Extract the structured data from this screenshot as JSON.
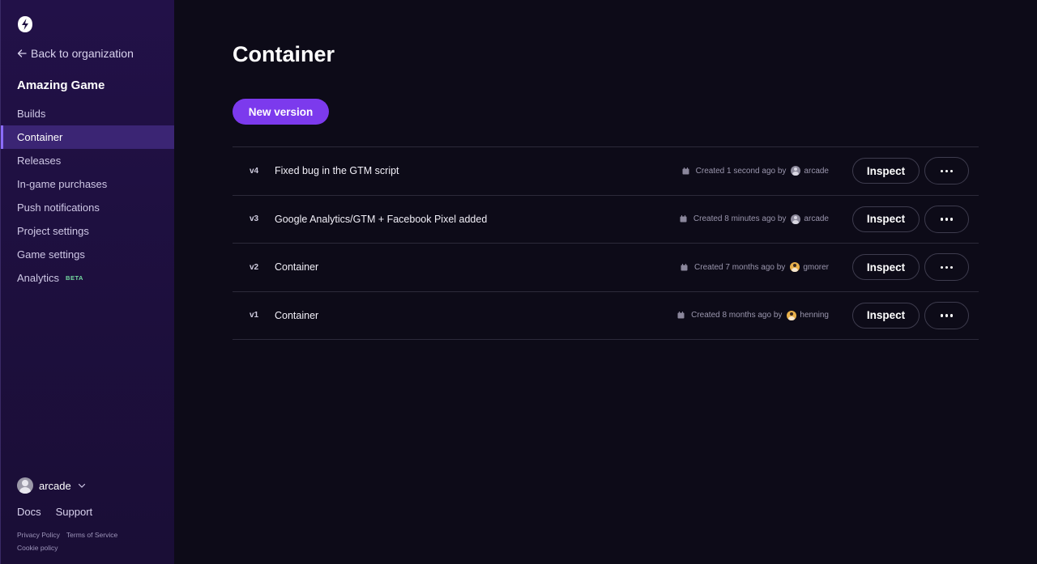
{
  "sidebar": {
    "back_label": "Back to organization",
    "project_title": "Amazing Game",
    "nav": [
      {
        "label": "Builds",
        "active": false
      },
      {
        "label": "Container",
        "active": true
      },
      {
        "label": "Releases",
        "active": false
      },
      {
        "label": "In-game purchases",
        "active": false
      },
      {
        "label": "Push notifications",
        "active": false
      },
      {
        "label": "Project settings",
        "active": false
      },
      {
        "label": "Game settings",
        "active": false
      },
      {
        "label": "Analytics",
        "active": false,
        "badge": "BETA"
      }
    ],
    "user": {
      "name": "arcade"
    },
    "links": {
      "docs": "Docs",
      "support": "Support"
    },
    "legal": {
      "privacy": "Privacy Policy",
      "terms": "Terms of Service",
      "cookie": "Cookie policy"
    }
  },
  "main": {
    "title": "Container",
    "new_version_label": "New version",
    "inspect_label": "Inspect",
    "versions": [
      {
        "version": "v4",
        "name": "Fixed bug in the GTM script",
        "created": "Created 1 second ago by",
        "author": "arcade",
        "avatar": "default"
      },
      {
        "version": "v3",
        "name": "Google Analytics/GTM + Facebook Pixel added",
        "created": "Created 8 minutes ago by",
        "author": "arcade",
        "avatar": "default"
      },
      {
        "version": "v2",
        "name": "Container",
        "created": "Created 7 months ago by",
        "author": "gmorer",
        "avatar": "custom"
      },
      {
        "version": "v1",
        "name": "Container",
        "created": "Created 8 months ago by",
        "author": "henning",
        "avatar": "custom"
      }
    ]
  },
  "colors": {
    "background": "#0d0b18",
    "sidebar": "#1f1042",
    "active_nav": "#3b2574",
    "accent": "#7c3aed",
    "beta": "#74d9a0"
  }
}
